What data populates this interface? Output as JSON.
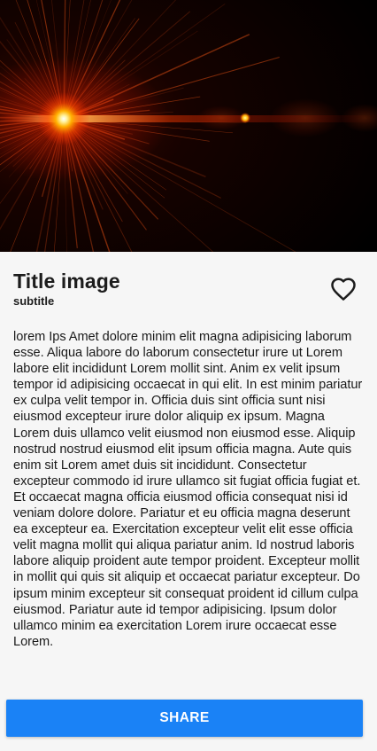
{
  "hero": {
    "image_name": "lens-flare-image"
  },
  "card": {
    "title": "Title image",
    "subtitle": "subtitle",
    "favorite_icon": "heart-outline-icon",
    "body": "lorem Ips Amet dolore minim elit magna adipisicing laborum esse. Aliqua labore do laborum consectetur irure ut Lorem labore elit incididunt Lorem mollit sint. Anim ex velit ipsum tempor id adipisicing occaecat in qui elit. In est minim pariatur ex culpa velit tempor in. Officia duis sint officia sunt nisi eiusmod excepteur irure dolor aliquip ex ipsum. Magna Lorem duis ullamco velit eiusmod non eiusmod esse. Aliquip nostrud nostrud eiusmod elit ipsum officia magna. Aute quis enim sit Lorem amet duis sit incididunt. Consectetur excepteur commodo id irure ullamco sit fugiat officia fugiat et. Et occaecat magna officia eiusmod officia consequat nisi id veniam dolore dolore. Pariatur et eu officia magna deserunt ea excepteur ea. Exercitation excepteur velit elit esse officia velit magna mollit qui aliqua pariatur anim. Id nostrud laboris labore aliquip proident aute tempor proident. Excepteur mollit in mollit qui quis sit aliquip et occaecat pariatur excepteur. Do ipsum minim excepteur sit consequat proident id cillum culpa eiusmod. Pariatur aute id tempor adipisicing. Ipsum dolor ullamco minim ea exercitation Lorem irure occaecat esse Lorem."
  },
  "actions": {
    "share_label": "SHARE"
  },
  "colors": {
    "primary": "#1a82f6",
    "background": "#f6f6f6",
    "text": "#1a1a1a"
  }
}
